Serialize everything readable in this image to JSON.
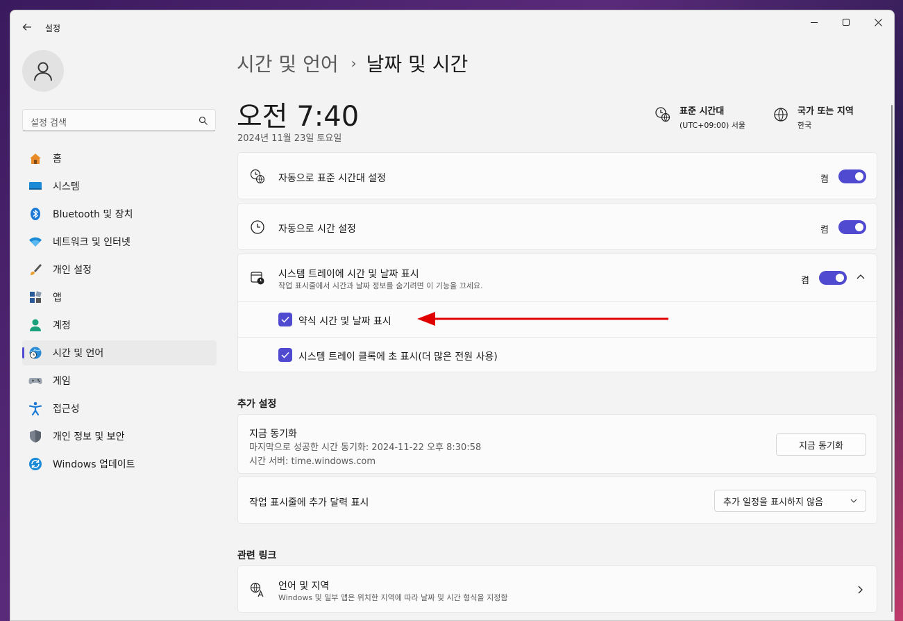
{
  "window": {
    "title": "설정"
  },
  "sidebar": {
    "search_placeholder": "설정 검색",
    "items": [
      {
        "label": "홈",
        "icon": "home-icon"
      },
      {
        "label": "시스템",
        "icon": "system-icon"
      },
      {
        "label": "Bluetooth 및 장치",
        "icon": "bluetooth-icon"
      },
      {
        "label": "네트워크 및 인터넷",
        "icon": "wifi-icon"
      },
      {
        "label": "개인 설정",
        "icon": "brush-icon"
      },
      {
        "label": "앱",
        "icon": "apps-icon"
      },
      {
        "label": "계정",
        "icon": "account-icon"
      },
      {
        "label": "시간 및 언어",
        "icon": "time-language-icon",
        "active": true
      },
      {
        "label": "게임",
        "icon": "gamepad-icon"
      },
      {
        "label": "접근성",
        "icon": "accessibility-icon"
      },
      {
        "label": "개인 정보 및 보안",
        "icon": "shield-icon"
      },
      {
        "label": "Windows 업데이트",
        "icon": "update-icon"
      }
    ]
  },
  "header": {
    "breadcrumb_parent": "시간 및 언어",
    "breadcrumb_sep": "›",
    "breadcrumb_current": "날짜 및 시간"
  },
  "clock": {
    "time": "오전 7:40",
    "date": "2024년 11월 23일 토요일"
  },
  "timezone": {
    "title": "표준 시간대",
    "value": "(UTC+09:00) 서울"
  },
  "region": {
    "title": "국가 또는 지역",
    "value": "한국"
  },
  "settings": {
    "auto_timezone": {
      "label": "자동으로 표준 시간대 설정",
      "state": "켬"
    },
    "auto_time": {
      "label": "자동으로 시간 설정",
      "state": "켬"
    },
    "tray": {
      "label": "시스템 트레이에 시간 및 날짜 표시",
      "sub": "작업 표시줄에서 시간과 날짜 정보를 숨기려면 이 기능을 끄세요.",
      "state": "켬",
      "options": [
        {
          "label": "약식 시간 및 날짜 표시",
          "checked": true
        },
        {
          "label": "시스템 트레이 클록에 초 표시(더 많은 전원 사용)",
          "checked": true
        }
      ]
    }
  },
  "additional": {
    "section_title": "추가 설정",
    "sync": {
      "title": "지금 동기화",
      "last": "마지막으로 성공한 시간 동기화: 2024-11-22 오후 8:30:58",
      "server": "시간 서버: time.windows.com",
      "button": "지금 동기화"
    },
    "calendar": {
      "label": "작업 표시줄에 추가 달력 표시",
      "selected": "추가 일정을 표시하지 않음"
    }
  },
  "related": {
    "section_title": "관련 링크",
    "language_region": {
      "title": "언어 및 지역",
      "sub": "Windows 및 일부 앱은 위치한 지역에 따라 날짜 및 시간 형식을 지정함"
    }
  },
  "colors": {
    "accent": "#4f4ad0",
    "annotation_arrow": "#e00000"
  }
}
